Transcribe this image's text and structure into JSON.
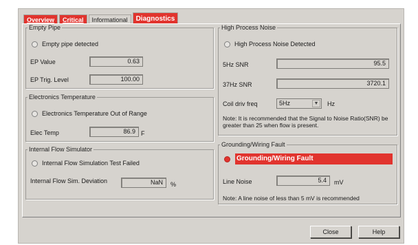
{
  "tabs": [
    {
      "label": "Overview"
    },
    {
      "label": "Critical"
    },
    {
      "label": "Informational"
    },
    {
      "label": "Diagnostics"
    }
  ],
  "empty_pipe": {
    "title": "Empty Pipe",
    "status_label": "Empty pipe detected",
    "ep_value_label": "EP Value",
    "ep_value": "0.63",
    "ep_trig_label": "EP Trig. Level",
    "ep_trig_value": "100.00"
  },
  "electronics_temp": {
    "title": "Electronics Temperature",
    "status_label": "Electronics Temperature Out of Range",
    "elec_temp_label": "Elec Temp",
    "elec_temp_value": "86.9",
    "elec_temp_unit": "F"
  },
  "flow_simulator": {
    "title": "Internal Flow Simulator",
    "status_label": "Internal Flow Simulation Test Failed",
    "deviation_label": "Internal Flow Sim. Deviation",
    "deviation_value": "NaN",
    "deviation_unit": "%"
  },
  "high_noise": {
    "title": "High Process Noise",
    "status_label": "High Process Noise Detected",
    "snr5_label": "5Hz SNR",
    "snr5_value": "95.5",
    "snr37_label": "37Hz SNR",
    "snr37_value": "3720.1",
    "coil_label": "Coil driv freq",
    "coil_value": "5Hz",
    "coil_unit": "Hz",
    "note": "Note: It is recommended that the Signal to Noise Ratio(SNR) be greater than 25 when flow is present."
  },
  "grounding": {
    "title": "Grounding/Wiring Fault",
    "status_label": "Grounding/Wiring Fault",
    "line_noise_label": "Line Noise",
    "line_noise_value": "5.4",
    "line_noise_unit": "mV",
    "note": "Note: A line noise of less than 5 mV is recommended"
  },
  "buttons": {
    "close": "Close",
    "help": "Help"
  },
  "colors": {
    "accent_red": "#e1342e",
    "dialog_bg": "#d6d3ce"
  }
}
